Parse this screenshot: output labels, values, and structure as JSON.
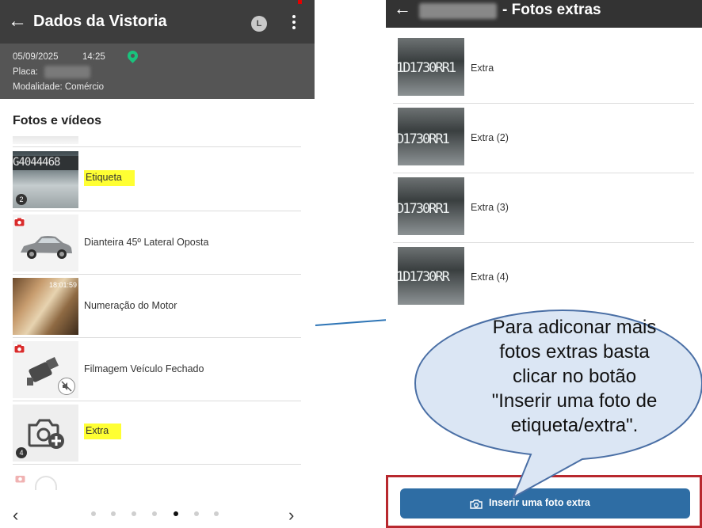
{
  "left": {
    "title": "Dados da Vistoria",
    "avatar_letter": "L",
    "info": {
      "date": "05/09/2025",
      "time": "14:25",
      "placa_label": "Placa:",
      "modalidade": "Modalidade: Comércio"
    },
    "section_title": "Fotos e vídeos",
    "items": [
      {
        "label": "Etiqueta",
        "count": "2",
        "thumb_text": "G4044468"
      },
      {
        "label": "Dianteira 45º Lateral Oposta"
      },
      {
        "label": "Numeração do Motor",
        "thumb_time": "18:01:59"
      },
      {
        "label": "Filmagem Veículo Fechado"
      },
      {
        "label": "Extra",
        "count": "4"
      }
    ],
    "pager": {
      "prev": "‹",
      "next": "›",
      "dot_count": 7,
      "active_dot": 4
    }
  },
  "right": {
    "title": "- Fotos extras",
    "items": [
      {
        "label": "Extra",
        "thumb_text": "1D1730RR1"
      },
      {
        "label": "Extra (2)",
        "thumb_text": "D1730RR1"
      },
      {
        "label": "Extra (3)",
        "thumb_text": "D1730RR1"
      },
      {
        "label": "Extra (4)",
        "thumb_text": "1D1730RR"
      }
    ],
    "insert_button": "Inserir uma foto extra"
  },
  "callout": {
    "lines": [
      "Para adiconar mais",
      "fotos extras basta",
      "clicar no botão",
      "\"Inserir uma foto de",
      "etiqueta/extra\"."
    ]
  },
  "colors": {
    "topbar": "#3d3d3d",
    "highlight": "#ffff33",
    "button": "#2e6da4",
    "frame": "#b8282e",
    "callout_fill": "#dbe6f4",
    "callout_stroke": "#4a6fa5"
  }
}
